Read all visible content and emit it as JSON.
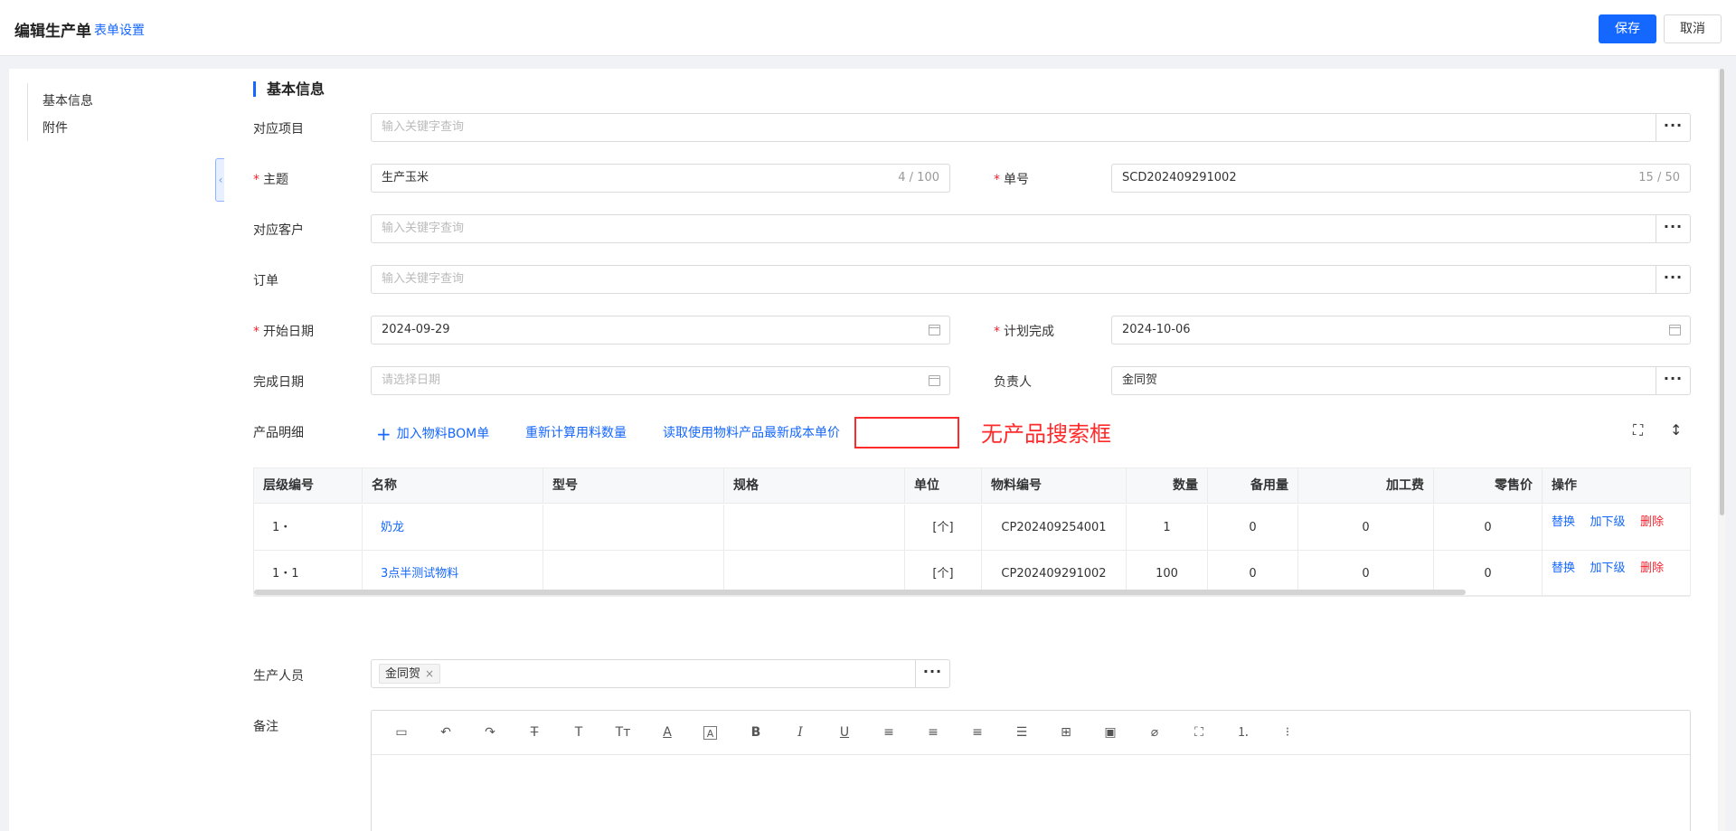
{
  "header": {
    "title": "编辑生产单",
    "form_settings": "表单设置",
    "save": "保存",
    "cancel": "取消"
  },
  "sidebar": {
    "items": [
      "基本信息",
      "附件"
    ],
    "collapse_icon": "chevron-left-icon"
  },
  "section": {
    "title": "基本信息"
  },
  "fields": {
    "project": {
      "label": "对应项目",
      "placeholder": "输入关键字查询"
    },
    "subject": {
      "label": "主题",
      "value": "生产玉米",
      "counter": "4 / 100",
      "required": true
    },
    "order_no": {
      "label": "单号",
      "value": "SCD202409291002",
      "counter": "15 / 50",
      "required": true
    },
    "customer": {
      "label": "对应客户",
      "placeholder": "输入关键字查询"
    },
    "order": {
      "label": "订单",
      "placeholder": "输入关键字查询"
    },
    "start_date": {
      "label": "开始日期",
      "value": "2024-09-29",
      "required": true
    },
    "plan_done": {
      "label": "计划完成",
      "value": "2024-10-06",
      "required": true
    },
    "done_date": {
      "label": "完成日期",
      "placeholder": "请选择日期"
    },
    "owner": {
      "label": "负责人",
      "value": "金同贺"
    },
    "staff": {
      "label": "生产人员",
      "tag": "金同贺"
    },
    "remark": {
      "label": "备注"
    }
  },
  "product": {
    "label": "产品明细",
    "actions": {
      "add_bom": "加入物料BOM单",
      "recalc": "重新计算用料数量",
      "read_cost": "读取使用物料产品最新成本单价"
    },
    "note": "无产品搜索框",
    "icons": [
      "fullscreen-icon",
      "vertical-resize-icon"
    ]
  },
  "table": {
    "columns": [
      "层级编号",
      "名称",
      "型号",
      "规格",
      "单位",
      "物料编号",
      "数量",
      "备用量",
      "加工费",
      "零售价",
      "操作"
    ],
    "rows": [
      {
        "level": "1・",
        "name": "奶龙",
        "model": "",
        "spec": "",
        "unit": "[个]",
        "code": "CP202409254001",
        "qty": "1",
        "spare": "0",
        "fee": "0",
        "price": "0"
      },
      {
        "level": "1・1",
        "name": "3点半测试物料",
        "model": "",
        "spec": "",
        "unit": "[个]",
        "code": "CP202409291002",
        "qty": "100",
        "spare": "0",
        "fee": "0",
        "price": "0"
      }
    ],
    "ops": [
      "替换",
      "加下级",
      "删除"
    ]
  },
  "editor_tools": [
    "template-icon",
    "undo-icon",
    "redo-icon",
    "strikethrough-icon",
    "text-icon",
    "font-size-icon",
    "font-color-icon",
    "bg-color-icon",
    "bold-icon",
    "italic-icon",
    "underline-icon",
    "align-left-icon",
    "align-center-icon",
    "align-right-icon",
    "justify-icon",
    "table-icon",
    "image-icon",
    "attachment-icon",
    "fullscreen-icon",
    "ordered-list-icon",
    "unordered-list-icon"
  ],
  "colors": {
    "primary": "#1467ff",
    "danger": "#f5222d",
    "annotation": "#ff2a2a"
  }
}
